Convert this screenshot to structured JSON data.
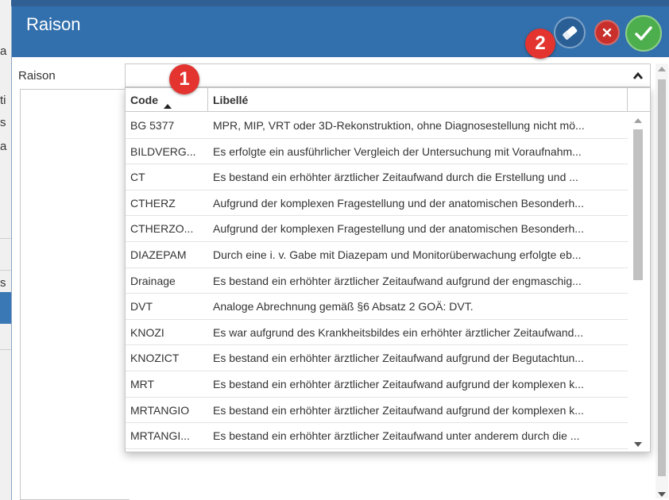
{
  "background": {
    "fragments": [
      "a",
      "ti",
      "s",
      "a",
      "s"
    ]
  },
  "dialog": {
    "title": "Raison",
    "field_label": "Raison",
    "combo_value": "",
    "badges": {
      "one": "1",
      "two": "2"
    },
    "icons": {
      "eraser": "eraser-icon",
      "cancel": "close-icon",
      "confirm": "checkmark-icon",
      "collapse": "chevron-up-icon"
    },
    "colors": {
      "titlebar": "#3270ad",
      "cancel": "#c9302c",
      "confirm": "#4cae4c",
      "badge": "#e3342f"
    }
  },
  "grid": {
    "columns": {
      "code": "Code",
      "libelle": "Libellé"
    },
    "sort": {
      "column": "code",
      "direction": "ascending"
    },
    "rows": [
      {
        "code": "BG 5377",
        "libelle": "MPR, MIP, VRT oder 3D-Rekonstruktion, ohne Diagnosestellung nicht mö..."
      },
      {
        "code": "BILDVERG...",
        "libelle": "Es erfolgte ein ausführlicher Vergleich der Untersuchung mit Voraufnahm..."
      },
      {
        "code": "CT",
        "libelle": "Es bestand ein erhöhter ärztlicher Zeitaufwand durch die Erstellung und ..."
      },
      {
        "code": "CTHERZ",
        "libelle": "Aufgrund der komplexen Fragestellung und der anatomischen Besonderh..."
      },
      {
        "code": "CTHERZO...",
        "libelle": "Aufgrund der komplexen Fragestellung und der anatomischen Besonderh..."
      },
      {
        "code": "DIAZEPAM",
        "libelle": "Durch eine i. v. Gabe mit Diazepam und Monitorüberwachung erfolgte eb..."
      },
      {
        "code": "Drainage",
        "libelle": "Es bestand ein erhöhter ärztlicher Zeitaufwand aufgrund der engmaschig..."
      },
      {
        "code": "DVT",
        "libelle": "Analoge Abrechnung gemäß §6 Absatz 2 GOÄ: DVT."
      },
      {
        "code": "KNOZI",
        "libelle": "Es war aufgrund des Krankheitsbildes ein erhöhter ärztlicher Zeitaufwand..."
      },
      {
        "code": "KNOZICT",
        "libelle": "Es bestand ein erhöhter ärztlicher Zeitaufwand aufgrund der Begutachtun..."
      },
      {
        "code": "MRT",
        "libelle": "Es bestand ein erhöhter ärztlicher Zeitaufwand aufgrund der komplexen k..."
      },
      {
        "code": "MRTANGIO",
        "libelle": "Es bestand ein erhöhter ärztlicher Zeitaufwand aufgrund der komplexen k..."
      },
      {
        "code": "MRTANGI...",
        "libelle": "Es bestand ein erhöhter ärztlicher Zeitaufwand unter anderem durch die ..."
      }
    ]
  }
}
